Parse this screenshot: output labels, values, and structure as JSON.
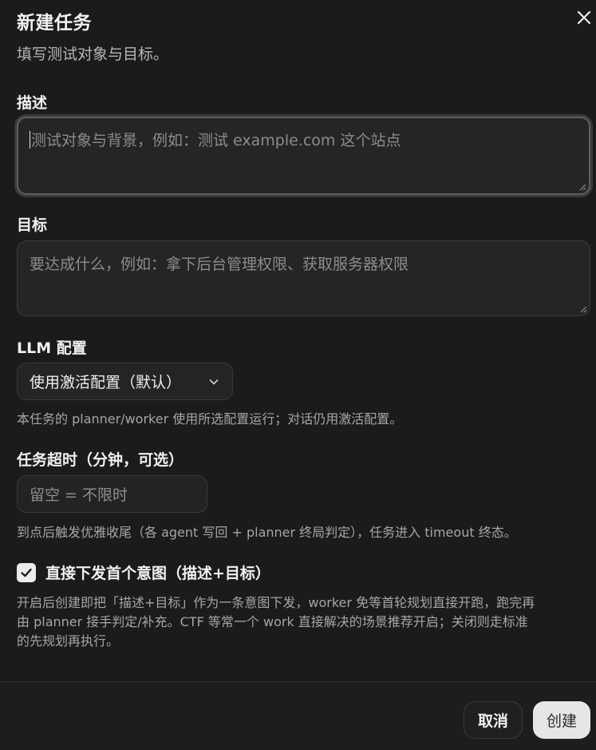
{
  "dialog": {
    "title": "新建任务",
    "subtitle": "填写测试对象与目标。",
    "close_icon": "close-icon"
  },
  "description": {
    "label": "描述",
    "placeholder": "测试对象与背景，例如：测试 example.com 这个站点",
    "value": ""
  },
  "goal": {
    "label": "目标",
    "placeholder": "要达成什么，例如：拿下后台管理权限、获取服务器权限",
    "value": ""
  },
  "llm": {
    "label": "LLM 配置",
    "selected": "使用激活配置（默认）",
    "help": "本任务的 planner/worker 使用所选配置运行；对话仍用激活配置。"
  },
  "timeout": {
    "label": "任务超时（分钟，可选）",
    "placeholder": "留空 = 不限时",
    "help": "到点后触发优雅收尾（各 agent 写回 + planner 终局判定），任务进入 timeout 终态。"
  },
  "direct_dispatch": {
    "checked": true,
    "label": "直接下发首个意图（描述+目标）",
    "help_lines": [
      "开启后创建即把「描述+目标」作为一条意图下发，worker 免等首轮规划直接开跑，跑完再",
      "由 planner 接手判定/补充。CTF 等常一个 work 直接解决的场景推荐开启；关闭则走标准",
      "的先规划再执行。"
    ]
  },
  "footer": {
    "cancel_label": "取消",
    "create_label": "创建"
  }
}
